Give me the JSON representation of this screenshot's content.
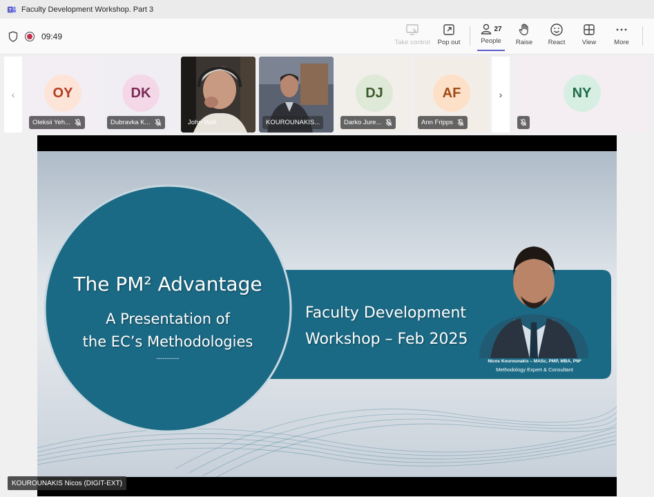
{
  "window": {
    "title": "Faculty Development Workshop. Part 3"
  },
  "meeting": {
    "timer": "09:49"
  },
  "toolbar": {
    "take_control": "Take control",
    "pop_out": "Pop out",
    "people": "People",
    "people_count": "27",
    "raise": "Raise",
    "react": "React",
    "view": "View",
    "more": "More"
  },
  "participants": [
    {
      "initials": "OY",
      "name": "Oleksii Yeh...",
      "avatar_bg": "#fde4d8",
      "avatar_fg": "#b53c1e"
    },
    {
      "initials": "DK",
      "name": "Dubravka K...",
      "avatar_bg": "#f4d8e8",
      "avatar_fg": "#7a2a55"
    },
    {
      "name": "John Wall"
    },
    {
      "name": "KOUROUNAKIS..."
    },
    {
      "initials": "DJ",
      "name": "Darko Jure...",
      "avatar_bg": "#dfe9d8",
      "avatar_fg": "#3c5a2a"
    },
    {
      "initials": "AF",
      "name": "Ann Fripps",
      "avatar_bg": "#fde0c8",
      "avatar_fg": "#a14a12"
    },
    {
      "initials": "NY",
      "name": "",
      "avatar_bg": "#d6efe2",
      "avatar_fg": "#1f6b45"
    }
  ],
  "slide": {
    "title": "The PM² Advantage",
    "subtitle_line1": "A Presentation of",
    "subtitle_line2": "the EC’s Methodologies",
    "dashes": "-----------",
    "banner_line1": "Faculty Development",
    "banner_line2": "Workshop – Feb 2025",
    "presenter_line1": "Nicos Kourounakis – MASc, PMP, MBA, PM²",
    "presenter_line2": "Methodology Expert & Consultant",
    "accent_color": "#1b6a85"
  },
  "presenter": {
    "label": "KOUROUNAKIS Nicos (DIGIT-EXT)"
  }
}
